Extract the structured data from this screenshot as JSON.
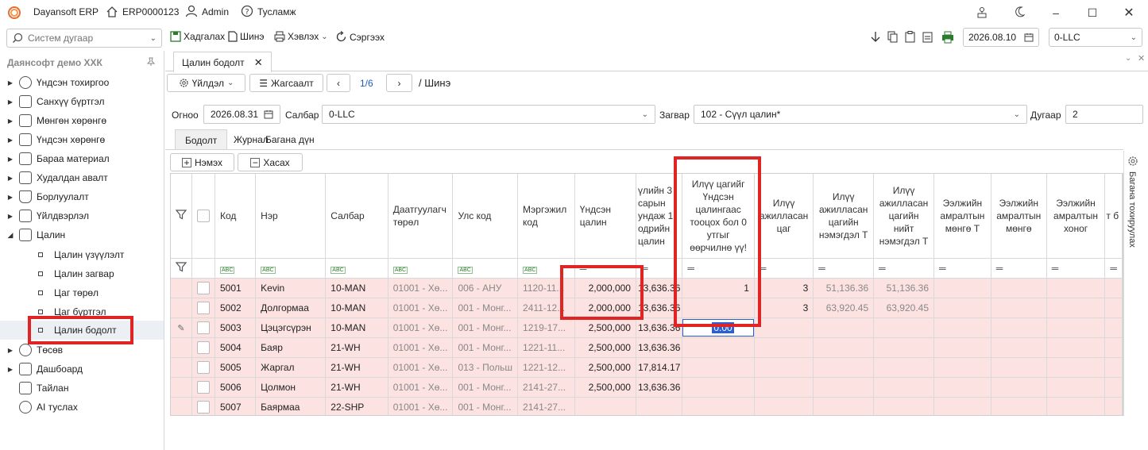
{
  "titlebar": {
    "app_name": "Dayansoft ERP",
    "db_code": "ERP0000123",
    "user": "Admin",
    "help": "Тусламж"
  },
  "toolbar": {
    "search_placeholder": "Систем дугаар",
    "save": "Хадгалах",
    "new": "Шинэ",
    "print": "Хэвлэх",
    "refresh": "Сэргээх",
    "date": "2026.08.10",
    "company": "0-LLC"
  },
  "sidebar": {
    "title": "Даянсофт демо ХХК",
    "items": [
      {
        "label": "Үндсэн тохиргоо"
      },
      {
        "label": "Санхүү бүртгэл"
      },
      {
        "label": "Мөнгөн хөрөнгө"
      },
      {
        "label": "Үндсэн хөрөнгө"
      },
      {
        "label": "Бараа материал"
      },
      {
        "label": "Худалдан авалт"
      },
      {
        "label": "Борлуулалт"
      },
      {
        "label": "Үйлдвэрлэл"
      },
      {
        "label": "Цалин"
      }
    ],
    "sub_items": [
      {
        "label": "Цалин үзүүлэлт"
      },
      {
        "label": "Цалин загвар"
      },
      {
        "label": "Цаг төрөл"
      },
      {
        "label": "Цаг бүртгэл"
      },
      {
        "label": "Цалин бодолт"
      }
    ],
    "bottom_items": [
      {
        "label": "Төсөв"
      },
      {
        "label": "Дашбоард"
      },
      {
        "label": "Тайлан"
      },
      {
        "label": "AI туслах"
      }
    ]
  },
  "tab": {
    "title": "Цалин бодолт"
  },
  "actions": {
    "operation": "Үйлдэл",
    "list": "Жагсаалт",
    "pager": "1/6",
    "mode": "/ Шинэ"
  },
  "form": {
    "date_label": "Огноо",
    "date_value": "2026.08.31",
    "branch_label": "Салбар",
    "branch_value": "0-LLC",
    "template_label": "Загвар",
    "template_value": "102 - Сүүл цалин*",
    "number_label": "Дугаар",
    "number_value": "2"
  },
  "subtabs": [
    "Бодолт",
    "Журнал",
    "Багана дүн"
  ],
  "grid_buttons": {
    "add": "Нэмэх",
    "remove": "Хасах"
  },
  "right_strip": "Багана тохируулах",
  "grid": {
    "headers": [
      "Код",
      "Нэр",
      "Салбар",
      "Даатгуулагч төрөл",
      "Улс код",
      "Мэргэжил код",
      "Үндсэн цалин",
      "үлийн 3 сарын ундаж 1 одрийн цалин",
      "Илүү цагийг Үндсэн цалингаас тооцох бол 0 утгыг өөрчилнө үү!",
      "Илүү ажилласан цаг",
      "Илүү ажилласан цагийн нэмэгдэл Т",
      "Илүү ажилласан цагийн нийт нэмэгдэл Т",
      "Ээлжийн амралтын мөнгө Т",
      "Ээлжийн амралтын мөнгө",
      "Ээлжийн амралтын хоног",
      "т б"
    ],
    "rows": [
      {
        "code": "5001",
        "name": "Kevin",
        "branch": "10-MAN",
        "ins": "01001 - Хө...",
        "country": "006 - АНУ",
        "prof": "1120-11...",
        "salary": "2,000,000",
        "avg": "13,636.36",
        "ot_flag": "1",
        "ot_hours": "3",
        "ot_add": "51,136.36",
        "ot_total": "51,136.36"
      },
      {
        "code": "5002",
        "name": "Долгормаа",
        "branch": "10-MAN",
        "ins": "01001 - Хө...",
        "country": "001 - Монг...",
        "prof": "2411-12...",
        "salary": "2,000,000",
        "avg": "13,636.36",
        "ot_flag": "",
        "ot_hours": "3",
        "ot_add": "63,920.45",
        "ot_total": "63,920.45"
      },
      {
        "code": "5003",
        "name": "Цэцэгсүрэн",
        "branch": "10-MAN",
        "ins": "01001 - Хө...",
        "country": "001 - Монг...",
        "prof": "1219-17...",
        "salary": "2,500,000",
        "avg": "13,636.36",
        "ot_flag": "0.00",
        "ot_hours": "",
        "ot_add": "",
        "ot_total": ""
      },
      {
        "code": "5004",
        "name": "Баяр",
        "branch": "21-WH",
        "ins": "01001 - Хө...",
        "country": "001 - Монг...",
        "prof": "1221-11...",
        "salary": "2,500,000",
        "avg": "13,636.36",
        "ot_flag": "",
        "ot_hours": "",
        "ot_add": "",
        "ot_total": ""
      },
      {
        "code": "5005",
        "name": "Жаргал",
        "branch": "21-WH",
        "ins": "01001 - Хө...",
        "country": "013 - Польш",
        "prof": "1221-12...",
        "salary": "2,500,000",
        "avg": "17,814.17",
        "ot_flag": "",
        "ot_hours": "",
        "ot_add": "",
        "ot_total": ""
      },
      {
        "code": "5006",
        "name": "Цолмон",
        "branch": "21-WH",
        "ins": "01001 - Хө...",
        "country": "001 - Монг...",
        "prof": "2141-27...",
        "salary": "2,500,000",
        "avg": "13,636.36",
        "ot_flag": "",
        "ot_hours": "",
        "ot_add": "",
        "ot_total": ""
      },
      {
        "code": "5007",
        "name": "Баярмаа",
        "branch": "22-SHP",
        "ins": "01001 - Хө...",
        "country": "001 - Монг...",
        "prof": "2141-27...",
        "salary": "",
        "avg": "",
        "ot_flag": "",
        "ot_hours": "",
        "ot_add": "",
        "ot_total": ""
      }
    ]
  },
  "colors": {
    "row_pink": "#fde2e2",
    "highlight_red": "#e02424",
    "edit_blue": "#2e5fd1"
  }
}
